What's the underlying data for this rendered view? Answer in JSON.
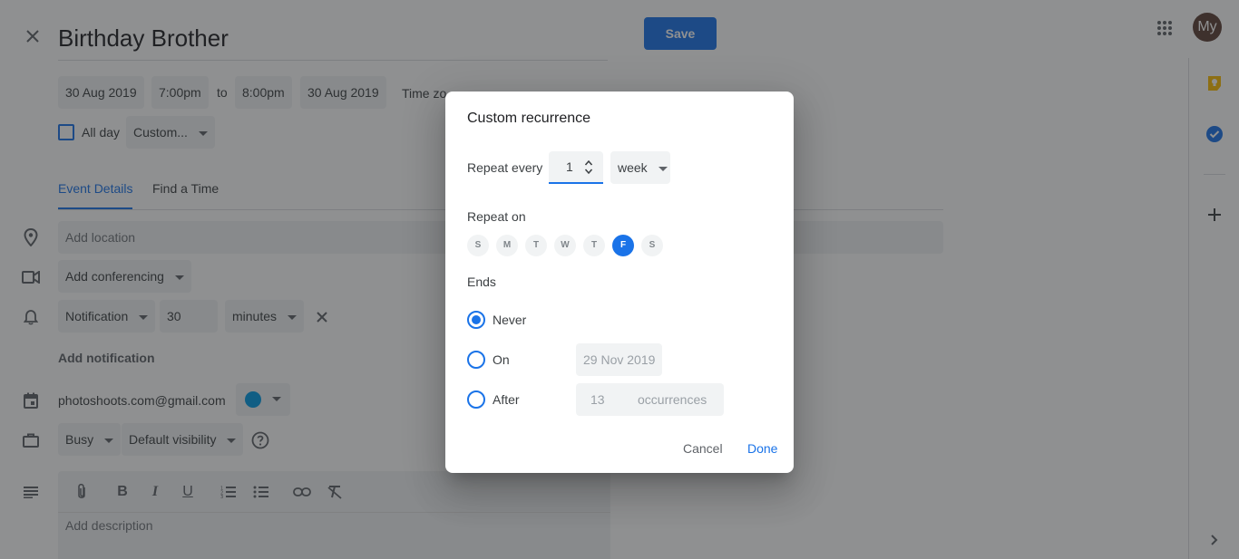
{
  "header": {
    "close_icon": "close-icon",
    "title": "Birthday Brother",
    "save_label": "Save",
    "apps_icon": "apps-grid-icon",
    "avatar_initials": "My"
  },
  "datetime": {
    "start_date": "30 Aug 2019",
    "start_time": "7:00pm",
    "to_label": "to",
    "end_time": "8:00pm",
    "end_date": "30 Aug 2019",
    "timezone_label": "Time zo",
    "all_day_label": "All day",
    "recurrence_value": "Custom..."
  },
  "tabs": [
    {
      "label": "Event Details",
      "active": true
    },
    {
      "label": "Find a Time",
      "active": false
    }
  ],
  "details": {
    "location_placeholder": "Add location",
    "conferencing_label": "Add conferencing",
    "notification_type": "Notification",
    "notification_value": "30",
    "notification_unit": "minutes",
    "add_notification_label": "Add notification",
    "calendar_email": "photoshoots.com@gmail.com",
    "calendar_color": "#039be5",
    "busy_value": "Busy",
    "visibility_value": "Default visibility",
    "description_placeholder": "Add description"
  },
  "dialog": {
    "title": "Custom recurrence",
    "repeat_every_label": "Repeat every",
    "repeat_every_value": "1",
    "repeat_unit": "week",
    "repeat_on_label": "Repeat on",
    "days": [
      {
        "label": "S",
        "selected": false
      },
      {
        "label": "M",
        "selected": false
      },
      {
        "label": "T",
        "selected": false
      },
      {
        "label": "W",
        "selected": false
      },
      {
        "label": "T",
        "selected": false
      },
      {
        "label": "F",
        "selected": true
      },
      {
        "label": "S",
        "selected": false
      }
    ],
    "ends_label": "Ends",
    "never_label": "Never",
    "on_label": "On",
    "on_date": "29 Nov 2019",
    "after_label": "After",
    "after_count": "13",
    "occurrences_label": "occurrences",
    "cancel_label": "Cancel",
    "done_label": "Done",
    "selected_end": "never"
  },
  "colors": {
    "accent": "#1a73e8",
    "save_button": "#1a73e8",
    "avatar_bg": "#5d4037"
  }
}
